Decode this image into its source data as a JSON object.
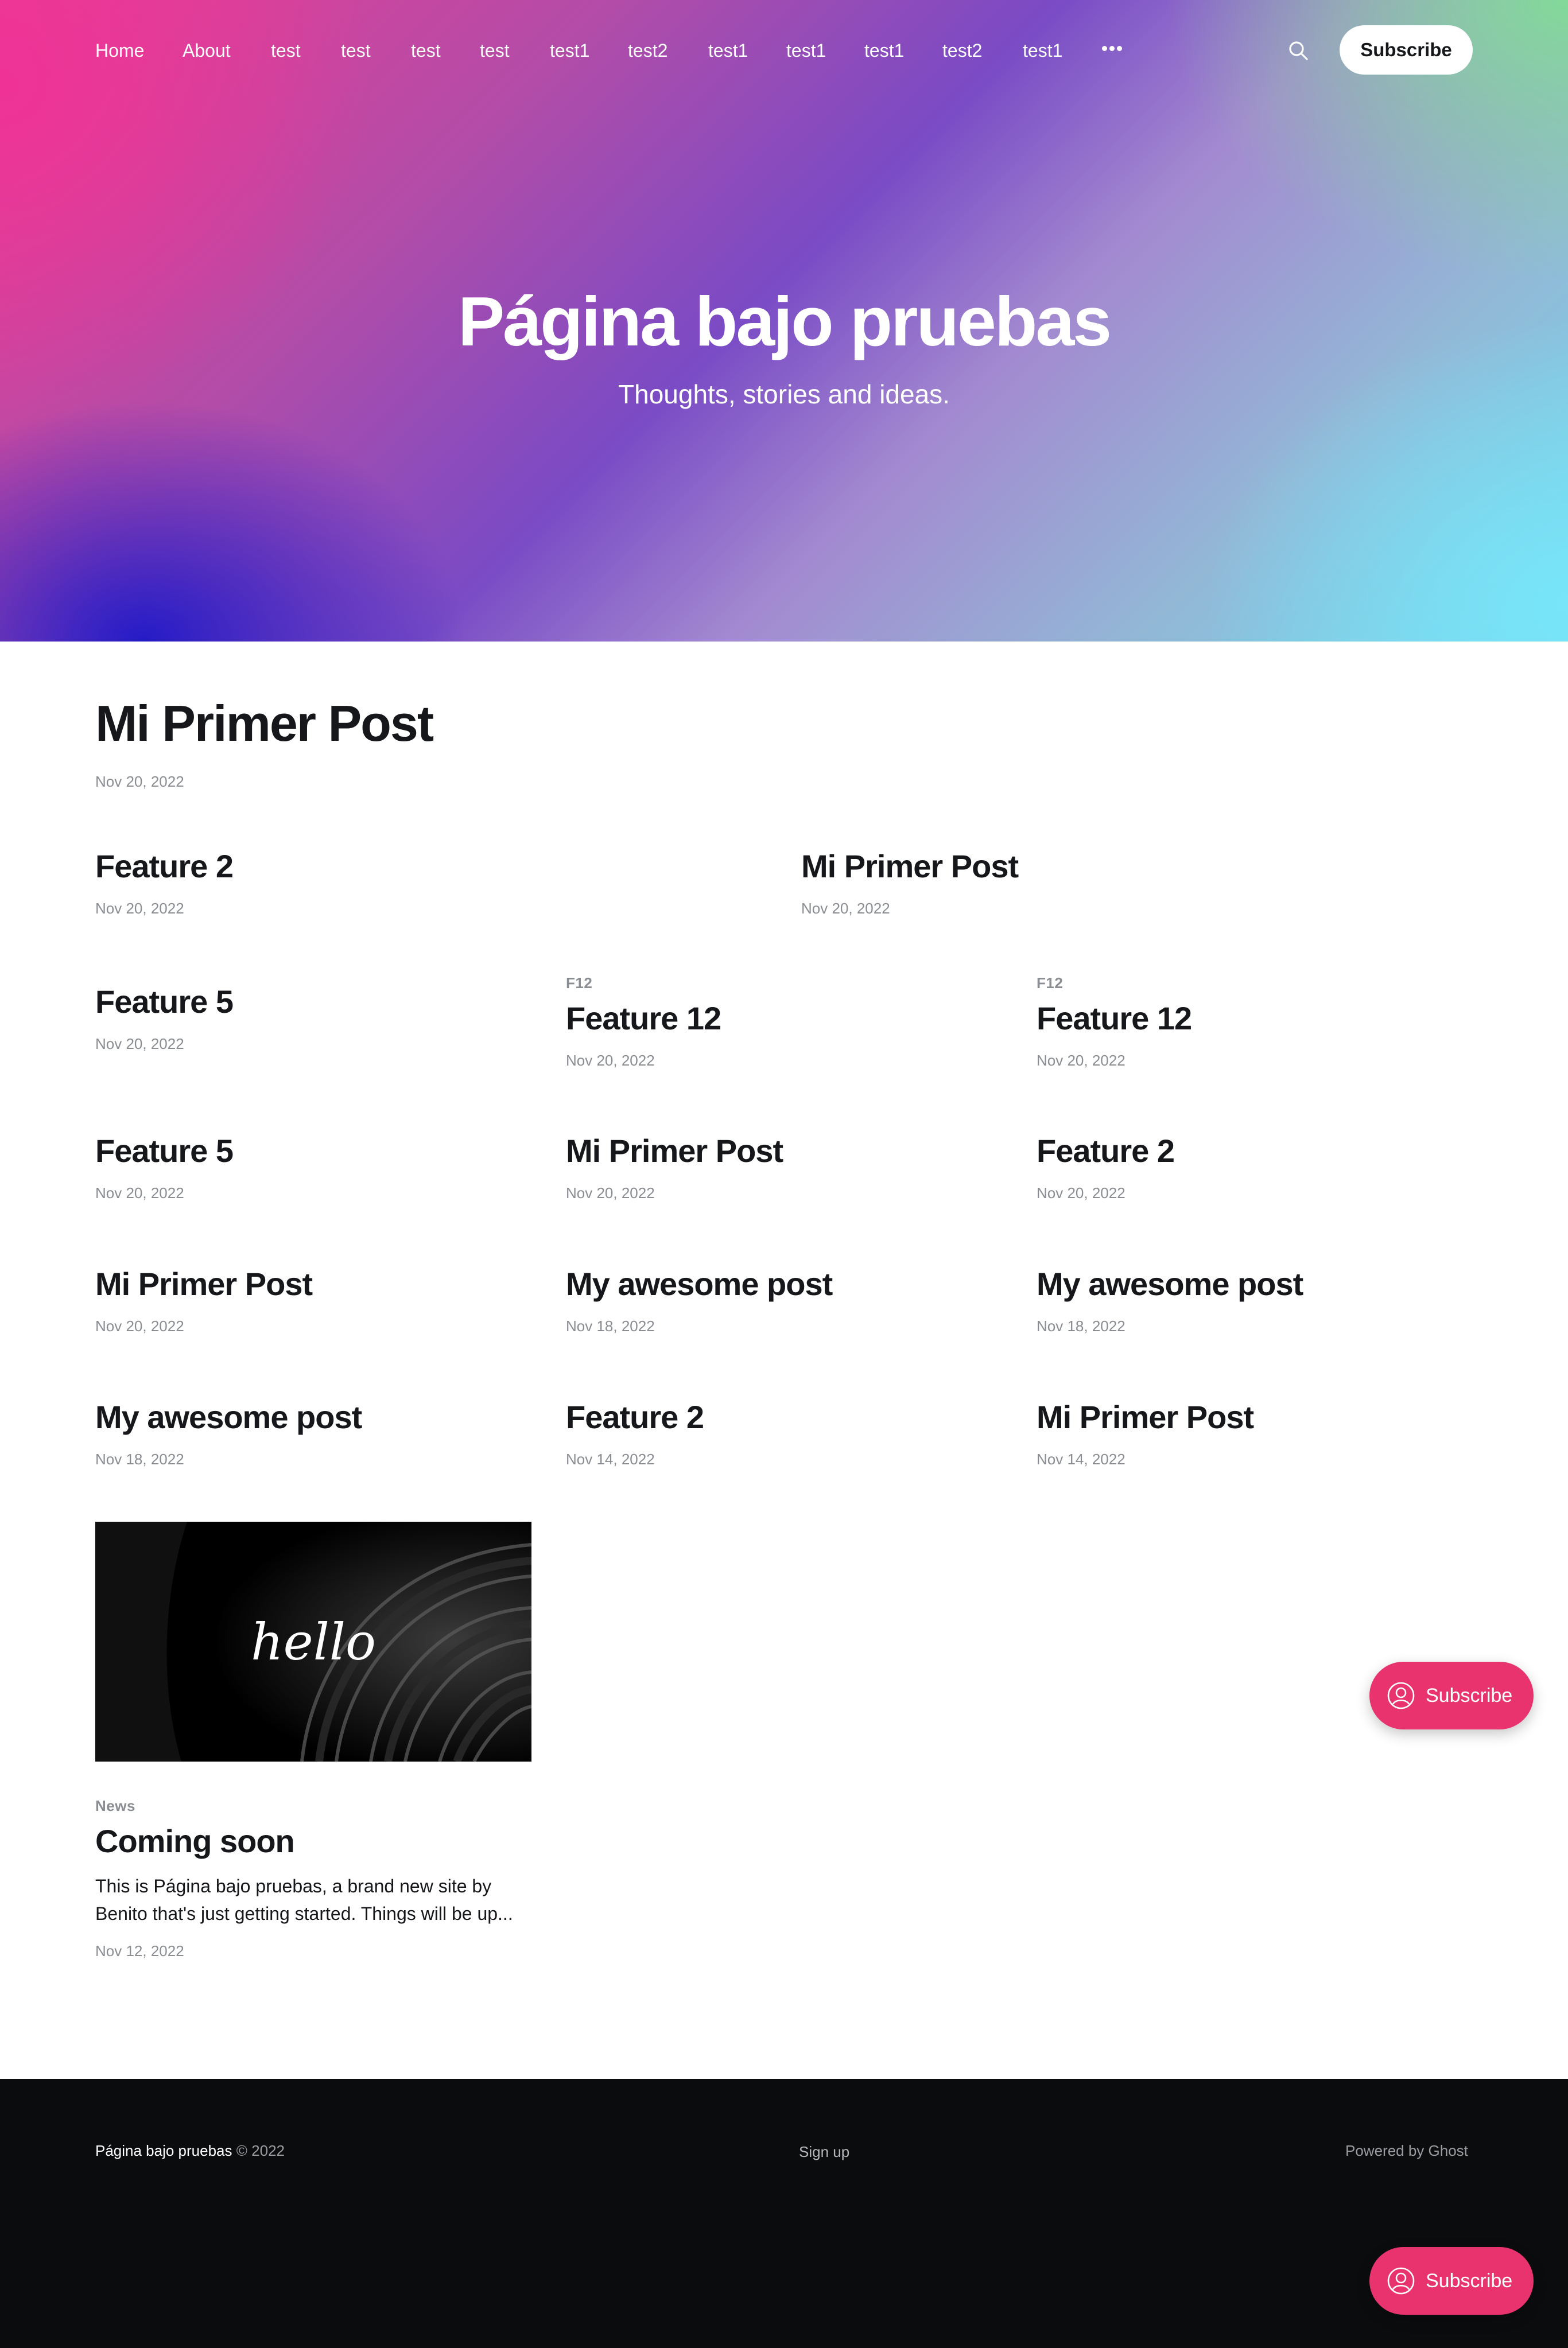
{
  "site": {
    "title": "Página bajo pruebas",
    "description": "Thoughts, stories and ideas."
  },
  "nav": {
    "items": [
      "Home",
      "About",
      "test",
      "test",
      "test",
      "test",
      "test1",
      "test2",
      "test1",
      "test1",
      "test1",
      "test2",
      "test1"
    ],
    "more_icon": "ellipsis-icon",
    "search_icon": "search-icon",
    "subscribe_label": "Subscribe"
  },
  "posts": [
    {
      "tag": "",
      "title": "Mi Primer Post",
      "date": "Nov 20, 2022"
    },
    {
      "tag": "",
      "title": "Feature 2",
      "date": "Nov 20, 2022"
    },
    {
      "tag": "",
      "title": "Mi Primer Post",
      "date": "Nov 20, 2022"
    },
    {
      "tag": "",
      "title": "Feature 5",
      "date": "Nov 20, 2022"
    },
    {
      "tag": "F12",
      "title": "Feature 12",
      "date": "Nov 20, 2022"
    },
    {
      "tag": "F12",
      "title": "Feature 12",
      "date": "Nov 20, 2022"
    },
    {
      "tag": "",
      "title": "Feature 5",
      "date": "Nov 20, 2022"
    },
    {
      "tag": "",
      "title": "Mi Primer Post",
      "date": "Nov 20, 2022"
    },
    {
      "tag": "",
      "title": "Feature 2",
      "date": "Nov 20, 2022"
    },
    {
      "tag": "",
      "title": "Mi Primer Post",
      "date": "Nov 20, 2022"
    },
    {
      "tag": "",
      "title": "My awesome post",
      "date": "Nov 18, 2022"
    },
    {
      "tag": "",
      "title": "My awesome post",
      "date": "Nov 18, 2022"
    },
    {
      "tag": "",
      "title": "My awesome post",
      "date": "Nov 18, 2022"
    },
    {
      "tag": "",
      "title": "Feature 2",
      "date": "Nov 14, 2022"
    },
    {
      "tag": "",
      "title": "Mi Primer Post",
      "date": "Nov 14, 2022"
    },
    {
      "tag": "News",
      "title": "Coming soon",
      "excerpt": "This is Página bajo pruebas, a brand new site by Benito that's just getting started. Things will be up...",
      "date": "Nov 12, 2022",
      "image_text": "hello"
    }
  ],
  "footer": {
    "site_name": "Página bajo pruebas",
    "copyright": "© 2022",
    "signup_label": "Sign up",
    "powered_by": "Powered by Ghost"
  },
  "portal": {
    "label": "Subscribe",
    "icon": "user-circle-icon"
  },
  "colors": {
    "accent": "#e8336e",
    "footer_bg": "#0b0c0e",
    "text": "#15171a",
    "meta": "#8a8d92"
  }
}
